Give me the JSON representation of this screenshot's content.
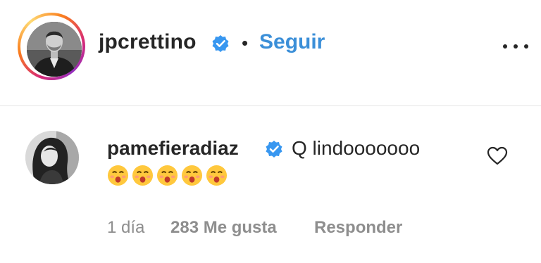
{
  "post_header": {
    "username": "jpcrettino",
    "verified": true,
    "separator": "•",
    "follow_label": "Seguir",
    "avatar_icon": "profile-photo-man",
    "story_ring_colors": [
      "#d62976",
      "#fa7e1e",
      "#feda75",
      "#962fbf"
    ],
    "more_icon": "more-horizontal-icon"
  },
  "comment": {
    "username": "pamefieradiaz",
    "verified": true,
    "text": "Q lindooooooo",
    "emojis": [
      "😚",
      "😚",
      "😚",
      "😚",
      "😚"
    ],
    "avatar_icon": "profile-photo-woman",
    "like_icon": "heart-outline-icon",
    "time": "1 día",
    "likes": "283 Me gusta",
    "reply_label": "Responder"
  },
  "colors": {
    "text": "#262626",
    "muted": "#8e8e8e",
    "accent_blue": "#3b8fd8",
    "verified_blue": "#3897f0",
    "divider": "#e6e6e6"
  }
}
